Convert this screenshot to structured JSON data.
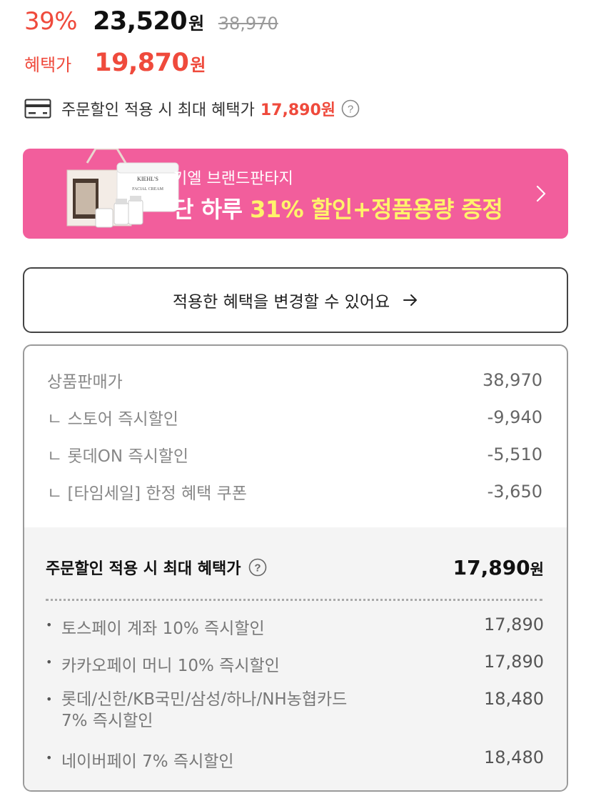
{
  "price": {
    "discount": "39%",
    "sale": "23,520",
    "won": "원",
    "original": "38,970"
  },
  "benefit": {
    "label": "혜택가",
    "price": "19,870",
    "won": "원"
  },
  "max_benefit": {
    "label": "주문할인 적용 시 최대 혜택가",
    "price": "17,890원",
    "icon": "credit-card-icon"
  },
  "banner": {
    "subtitle": "키엘 브랜드판타지",
    "title_prefix": "단 하루 ",
    "title_highlight": "31% 할인+정품용량 증정",
    "background": "#f25e9c",
    "highlight_color": "#fff36b"
  },
  "change_button": {
    "label": "적용한 혜택을 변경할 수 있어요"
  },
  "breakdown": [
    {
      "label": "상품판매가",
      "value": "38,970"
    },
    {
      "label": "ㄴ 스토어 즉시할인",
      "value": "-9,940"
    },
    {
      "label": "ㄴ 롯데ON 즉시할인",
      "value": "-5,510"
    },
    {
      "label": "ㄴ [타임세일] 한정 혜택 쿠폰",
      "value": "-3,650"
    }
  ],
  "summary": {
    "title": "주문할인 적용 시 최대 혜택가",
    "price": "17,890",
    "won": "원"
  },
  "payments": [
    {
      "label": "토스페이 계좌 10% 즉시할인",
      "value": "17,890"
    },
    {
      "label": "카카오페이 머니 10% 즉시할인",
      "value": "17,890"
    },
    {
      "label": "롯데/신한/KB국민/삼성/하나/NH농협카드\n7% 즉시할인",
      "value": "18,480"
    },
    {
      "label": "네이버페이 7% 즉시할인",
      "value": "18,480"
    }
  ],
  "colors": {
    "accent_red": "#ef4a3c",
    "banner_pink": "#f25e9c"
  }
}
